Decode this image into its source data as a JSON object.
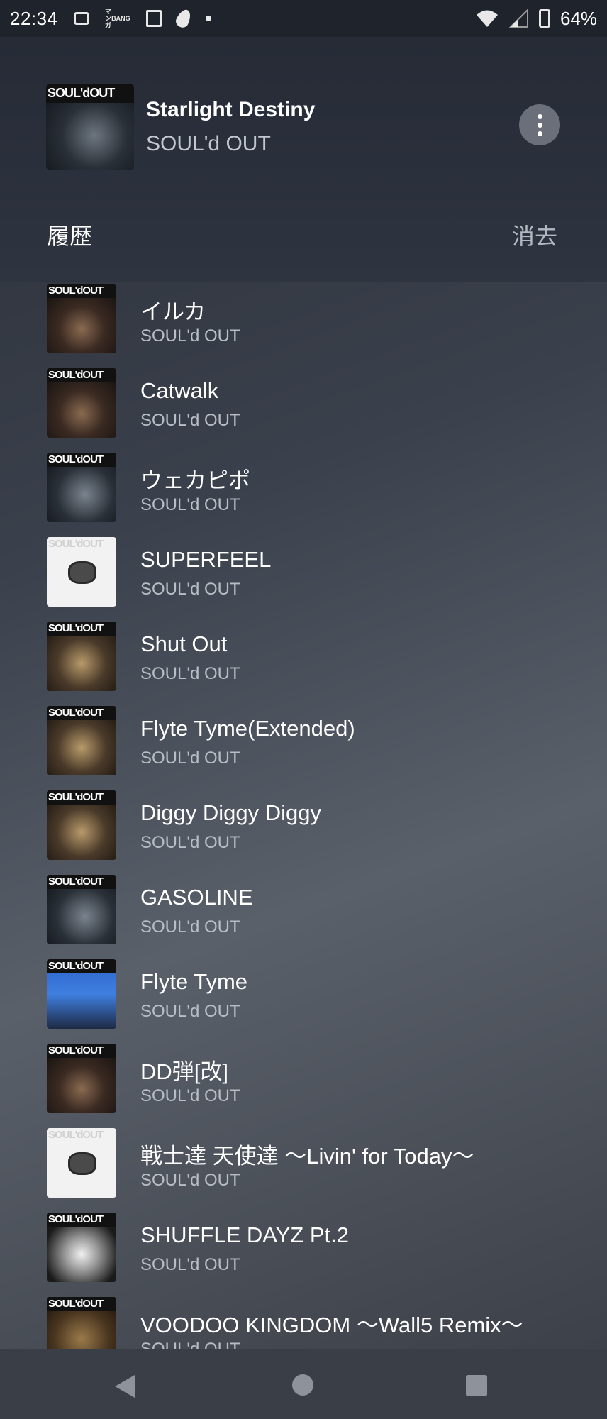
{
  "status_bar": {
    "time": "22:34",
    "manga_icon_text_line1": "マンガ",
    "manga_icon_text_line2": "BANG",
    "battery": "64%"
  },
  "now_playing": {
    "title": "Starlight Destiny",
    "artist": "SOUL'd OUT",
    "art_logo": "SOUL'dOUT"
  },
  "history": {
    "label": "履歴",
    "clear_label": "消去"
  },
  "tracks": [
    {
      "title": "イルカ",
      "artist": "SOUL'd OUT",
      "cover": "band"
    },
    {
      "title": "Catwalk",
      "artist": "SOUL'd OUT",
      "cover": "band"
    },
    {
      "title": "ウェカピポ",
      "artist": "SOUL'd OUT",
      "cover": "hand"
    },
    {
      "title": "SUPERFEEL",
      "artist": "SOUL'd OUT",
      "cover": "white"
    },
    {
      "title": "Shut Out",
      "artist": "SOUL'd OUT",
      "cover": "gold"
    },
    {
      "title": "Flyte Tyme(Extended)",
      "artist": "SOUL'd OUT",
      "cover": "gold"
    },
    {
      "title": "Diggy Diggy Diggy",
      "artist": "SOUL'd OUT",
      "cover": "gold"
    },
    {
      "title": "GASOLINE",
      "artist": "SOUL'd OUT",
      "cover": "hand"
    },
    {
      "title": "Flyte Tyme",
      "artist": "SOUL'd OUT",
      "cover": "blue"
    },
    {
      "title": "DD弾[改]",
      "artist": "SOUL'd OUT",
      "cover": "band"
    },
    {
      "title": "戦士達 天使達 〜Livin' for Today〜",
      "artist": "SOUL'd OUT",
      "cover": "white"
    },
    {
      "title": "SHUFFLE DAYZ Pt.2",
      "artist": "SOUL'd OUT",
      "cover": "shuffle"
    },
    {
      "title": "VOODOO KINGDOM 〜Wall5 Remix〜",
      "artist": "SOUL'd OUT",
      "cover": "voodoo"
    }
  ],
  "cover_logo": "SOUL'dOUT"
}
